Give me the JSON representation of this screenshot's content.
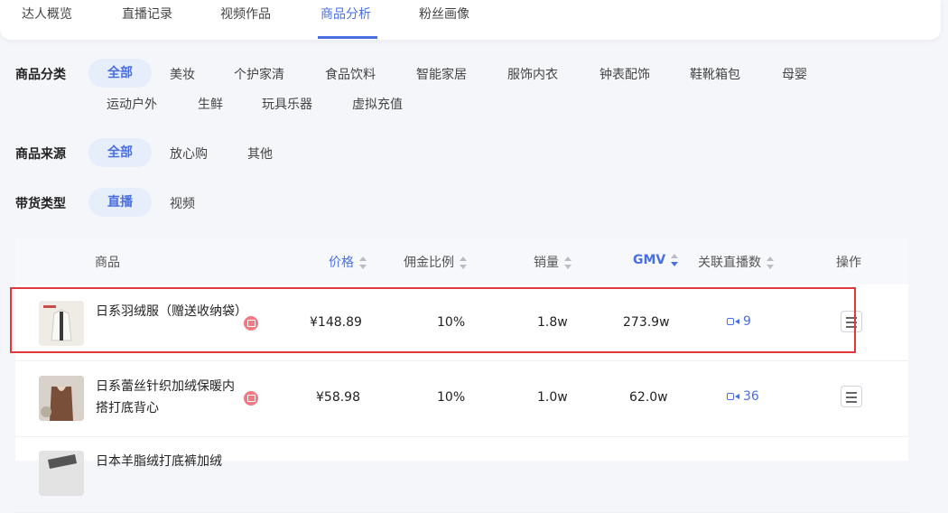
{
  "tabs": [
    {
      "label": "达人概览"
    },
    {
      "label": "直播记录"
    },
    {
      "label": "视频作品"
    },
    {
      "label": "商品分析",
      "active": true
    },
    {
      "label": "粉丝画像"
    }
  ],
  "filters": {
    "category": {
      "label": "商品分类",
      "options": [
        "全部",
        "美妆",
        "个护家清",
        "食品饮料",
        "智能家居",
        "服饰内衣",
        "钟表配饰",
        "鞋靴箱包",
        "母婴",
        "运动户外",
        "生鲜",
        "玩具乐器",
        "虚拟充值"
      ],
      "selected": "全部"
    },
    "source": {
      "label": "商品来源",
      "options": [
        "全部",
        "放心购",
        "其他"
      ],
      "selected": "全部"
    },
    "type": {
      "label": "带货类型",
      "options": [
        "直播",
        "视频"
      ],
      "selected": "直播"
    }
  },
  "table": {
    "headers": {
      "product": "商品",
      "price": "价格",
      "commission": "佣金比例",
      "sales": "销量",
      "gmv": "GMV",
      "live_count": "关联直播数",
      "action": "操作"
    },
    "sorted_by": "GMV",
    "rows": [
      {
        "name": "日系羽绒服（赠送收纳袋）",
        "price": "¥148.89",
        "commission": "10%",
        "sales": "1.8w",
        "gmv": "273.9w",
        "live_count": "9"
      },
      {
        "name": "日系蕾丝针织加绒保暖内搭打底背心",
        "price": "¥58.98",
        "commission": "10%",
        "sales": "1.0w",
        "gmv": "62.0w",
        "live_count": "36"
      },
      {
        "name": "日本羊脂绒打底裤加绒"
      }
    ]
  },
  "colors": {
    "accent": "#4a6fe3",
    "highlight_border": "#e0383b",
    "shop_badge": "#f07a84"
  }
}
